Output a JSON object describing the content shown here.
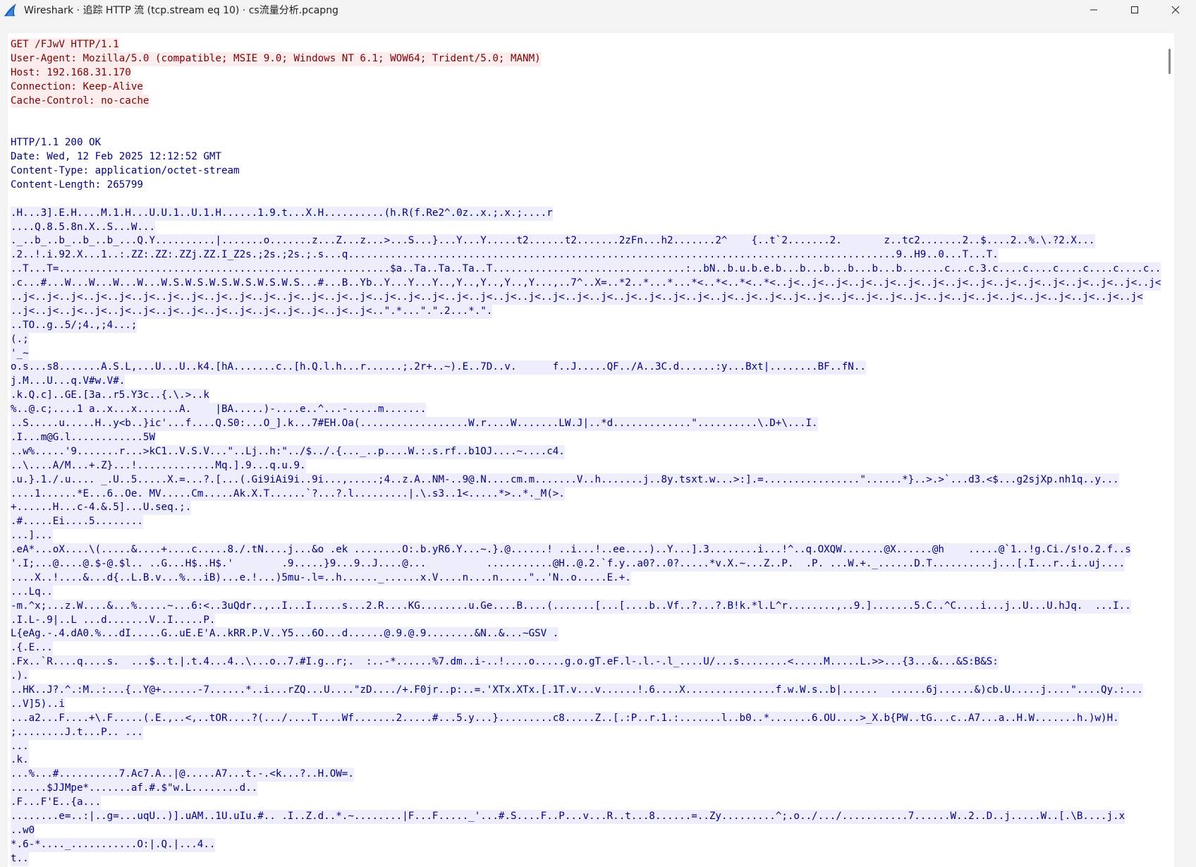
{
  "window": {
    "title": "Wireshark · 追踪 HTTP 流 (tcp.stream eq 10) · cs流量分析.pcapng",
    "icon": "wireshark-fin-icon",
    "controls": [
      "minimize-icon",
      "maximize-icon",
      "close-icon"
    ]
  },
  "colors": {
    "client_text": "#7f0000",
    "client_bg": "#fbeded",
    "server_text": "#00007f",
    "server_bg": "#ededfb"
  },
  "request": [
    "GET /FJwV HTTP/1.1",
    "User-Agent: Mozilla/5.0 (compatible; MSIE 9.0; Windows NT 6.1; WOW64; Trident/5.0; MANM)",
    "Host: 192.168.31.170",
    "Connection: Keep-Alive",
    "Cache-Control: no-cache"
  ],
  "response_headers": [
    "HTTP/1.1 200 OK",
    "Date: Wed, 12 Feb 2025 12:12:52 GMT",
    "Content-Type: application/octet-stream",
    "Content-Length: 265799"
  ],
  "response_body": [
    ".H...3].E.H....M.1.H...U.U.1..U.1.H......1.9.t...X.H..........(h.R(f.Re2^.0z..x.;.x.;....r",
    "....Q.8.5.8n.X..S...W...",
    "._..b_..b_..b_..b_...Q.Y..........|.......o.......z...Z...z...>...S...}...Y...Y.....t2......t2.......2zFn...h2.......2^    {..t`2.......2.       z..tc2.......2..$....2..%.\\.?2.X...",
    ".2..!.i.92.X...1..:.ZZ:.ZZ:.ZZj.ZZ.I_Z2s.;2s.;2s.;.s...q...........................................................................................9..H9..0...T...T.",
    "..T...T=.......................................................$a..Ta..Ta..Ta..T................................:..bN..b.u.b.e.b...b...b...b...b...b.......c...c.3.c....c....c....c....c....c..",
    ".c...#...W...W...W...W...W.S.W.S.W.S.W.S.W.S.W.S...#...B..Yb..Y...Y...Y..,Y..,Y..,Y..,Y...,..7^..X=..*2..*...*...*<..*<..*<..*<..j<..j<..j<..j<..j<..j<..j<..j<..j<..j<..j<..j<..j<..j<..j<..j<",
    "..j<..j<..j<..j<..j<..j<..j<..j<..j<..j<..j<..j<..j<..j<..j<..j<..j<..j<..j<..j<..j<..j<..j<..j<..j<..j<..j<..j<..j<..j<..j<..j<..j<..j<..j<..j<..j<..j<..j<..j<..j<..j<..j<..j<..j<..j<..j<",
    "..j<..j<..j<..j<..j<..j<..j<..j<..j<..j<..j<..j<..j<..j<..j<..\".*...\".\".2...*.\".",
    "..TO..g..5/;4.,;4...;",
    "(.;",
    "'_~",
    "o.s...s8.......A.S.L,...U...U..k4.[hA.......c..[h.Q.l.h...r......;.2r+..~).E..7D..v.      f..J.....QF../A..3C.d......:y...Bxt|........BF..fN..",
    "j.M...U...q.V#w.V#.",
    ".k.Q.c]..GE.[3a..r5.Y3c..{.\\.>..k",
    "%..@.c;....1 a..x...x.......A.    |BA.....)-....e..^...-.....m.......",
    "..S.....u.....H..y<b..}ic'...f....Q.S0:...O_].k...7#EH.Oa(..................W.r....W.......LW.J|..*d.............\"..........\\.D+\\...I.",
    ".I...m@G.l............5W",
    "..w%.....'9.......r...>kC1..V.S.V...\"..Lj..h:\"../$../.{..._..p....W.:.s.rf..b1OJ....~....c4.",
    "..\\....A/M...+.Z}...!.............Mq.].9...q.u.9.",
    ".u.}.1./.u.... _.U..5.....X.=...?.[...(.Gi9iAi9i..9i...,.....;4..z.A..NM-..9@.N....cm.m.......V..h.......j..8y.tsxt.w...>:].=................\"......*}..>.>`...d3.<$...g2sjXp.nh1q..y...",
    "....1......*E...6..Oe. MV.....Cm.....Ak.X.T......`?...?.l.........|.\\.s3..1<.....*>..*._M(>.",
    "+......H...c-4.&.5]...U.seq.;.",
    ".#.....Ei....5........",
    "...]...",
    ".eA*...oX....\\(.....&....+....c.....8./.tN....j...&o .ek ........O:.b.yR6.Y...~.}.@......! ..i...!..ee....)..Y...].3........i...!^..q.OXQW.......@X......@h    .....@`1..!g.Ci./s!o.2.f..s",
    "'.I;...@....@.$-@.$l.. ..G...H$..H$.'        .9.....}9...9..J....@...          ...........@H..@.2.`f.y..a0?..0?.....*v.X.~...Z..P.  .P. ...W.+._......D.T..........j...[.I...r..i..uj....",
    "....X..!....&...d{..L.B.v...%...iB)...e.!...)5mu-.l=..h......_......x.V....n....n.....\"..'N..o.....E.+.",
    "...Lq..",
    "-m.^x;...z.W....&...%.....~...6:<..3uQdr..,..I...I.....s...2.R....KG........u.Ge....B....(.......[...[....b..Vf..?...?.B!k.*l.L^r........,..9.].......5.C..^C....i...j..U...U.hJq.  ...I..",
    ".I.L-.9|..L ...d.......V..I.....P.",
    "L{eAg.-.4.dA0.%...dI.....G..uE.E'A..kRR.P.V..Y5...6O...d......@.9.@.9........&N..&...~GSV .",
    ".{.E...",
    ".Fx..`R....q....s.  ...$..t.|.t.4...4..\\...o..7.#I.g..r;.  :..-*......%7.dm..i-..!....o.....g.o.gT.eF.l-.l.-.l_....U/...s........<.....M.....L.>>...{3...&...&S:B&S:",
    ".).",
    "..HK..J?.^.:M..:...{..Y@+......-7......*..i...rZQ...U....\"zD..../+.F0jr..p:..=.'XTx.XTx.[.1T.v...v......!.6....X...............f.w.W.s..b|......  ......6j......&)cb.U.....j....\"....Qy.:...",
    "..V]5)..i",
    "...a2...F....+\\.F.....(.E.,..<,..tOR....?(.../....T....Wf.......2.....#...5.y...}.........c8.....Z..[.:P..r.1.:.......l..b0..*.......6.OU....>_X.b{PW..tG...c..A7...a..H.W.......h.)w)H.",
    ";........J.t...P.. ...",
    "...",
    ".k.",
    "...%...#..........7.Ac7.A..|@.....A7...t.-.<k...?..H.OW=.",
    "......$JJMpe*.......af.#.$\"w.L........d..",
    ".F...F'E..{a...",
    "........e=..:|..g=...uqU..)].uAM..1U.uIu.#.. .I..Z.d..*.~........|F...F....._'...#.S....F..P...v...R..t...8......=..Zy.........^;.o../.../...........7......W..2..D..j.....W..[.\\B....j.x",
    "..w0",
    "*.6-*...._...........O:|.Q.|...4..",
    "t.."
  ]
}
